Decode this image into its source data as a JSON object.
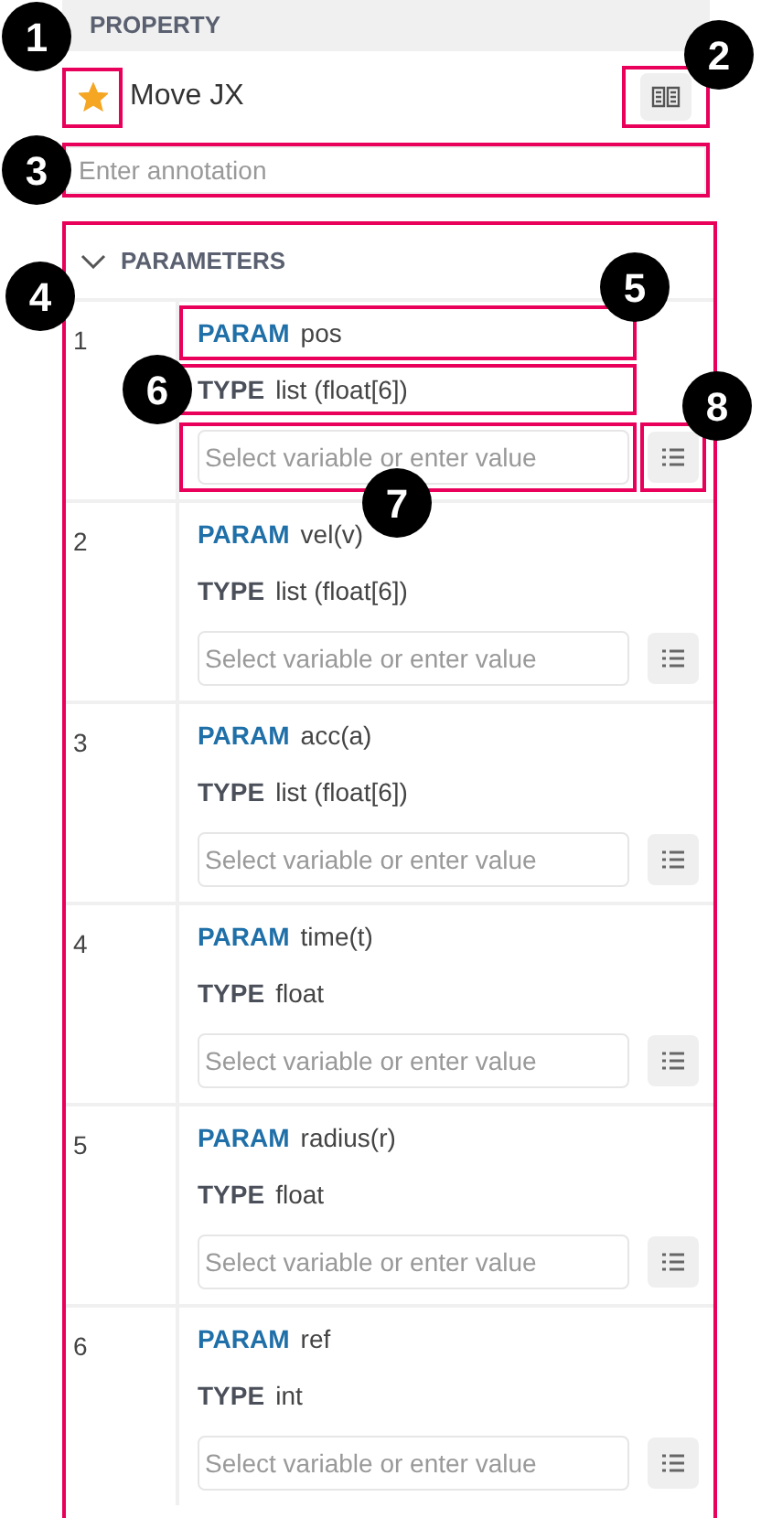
{
  "property": {
    "header": "PROPERTY",
    "favorite": {
      "on": true,
      "highlighted": true
    },
    "title": "Move JX",
    "manual_button": {
      "highlighted": true
    },
    "annotation": {
      "placeholder": "Enter annotation",
      "highlighted": true
    }
  },
  "parameters": {
    "header": "PARAMETERS",
    "expanded": true,
    "highlighted": true,
    "rows": [
      {
        "index": "1",
        "param_label": "PARAM",
        "param": "pos",
        "type_label": "TYPE",
        "type": "list (float[6])",
        "placeholder": "Select variable or enter value",
        "param_highlighted": true,
        "type_highlighted": true,
        "input_highlighted": true,
        "button_highlighted": true
      },
      {
        "index": "2",
        "param_label": "PARAM",
        "param": "vel(v)",
        "type_label": "TYPE",
        "type": "list (float[6])",
        "placeholder": "Select variable or enter value",
        "param_highlighted": false,
        "type_highlighted": false,
        "input_highlighted": false,
        "button_highlighted": false
      },
      {
        "index": "3",
        "param_label": "PARAM",
        "param": "acc(a)",
        "type_label": "TYPE",
        "type": "list (float[6])",
        "placeholder": "Select variable or enter value",
        "param_highlighted": false,
        "type_highlighted": false,
        "input_highlighted": false,
        "button_highlighted": false
      },
      {
        "index": "4",
        "param_label": "PARAM",
        "param": "time(t)",
        "type_label": "TYPE",
        "type": "float",
        "placeholder": "Select variable or enter value",
        "param_highlighted": false,
        "type_highlighted": false,
        "input_highlighted": false,
        "button_highlighted": false
      },
      {
        "index": "5",
        "param_label": "PARAM",
        "param": "radius(r)",
        "type_label": "TYPE",
        "type": "float",
        "placeholder": "Select variable or enter value",
        "param_highlighted": false,
        "type_highlighted": false,
        "input_highlighted": false,
        "button_highlighted": false
      },
      {
        "index": "6",
        "param_label": "PARAM",
        "param": "ref",
        "type_label": "TYPE",
        "type": "int",
        "placeholder": "Select variable or enter value",
        "param_highlighted": false,
        "type_highlighted": false,
        "input_highlighted": false,
        "button_highlighted": false
      }
    ]
  },
  "callouts": [
    "1",
    "2",
    "3",
    "4",
    "5",
    "6",
    "7",
    "8"
  ]
}
